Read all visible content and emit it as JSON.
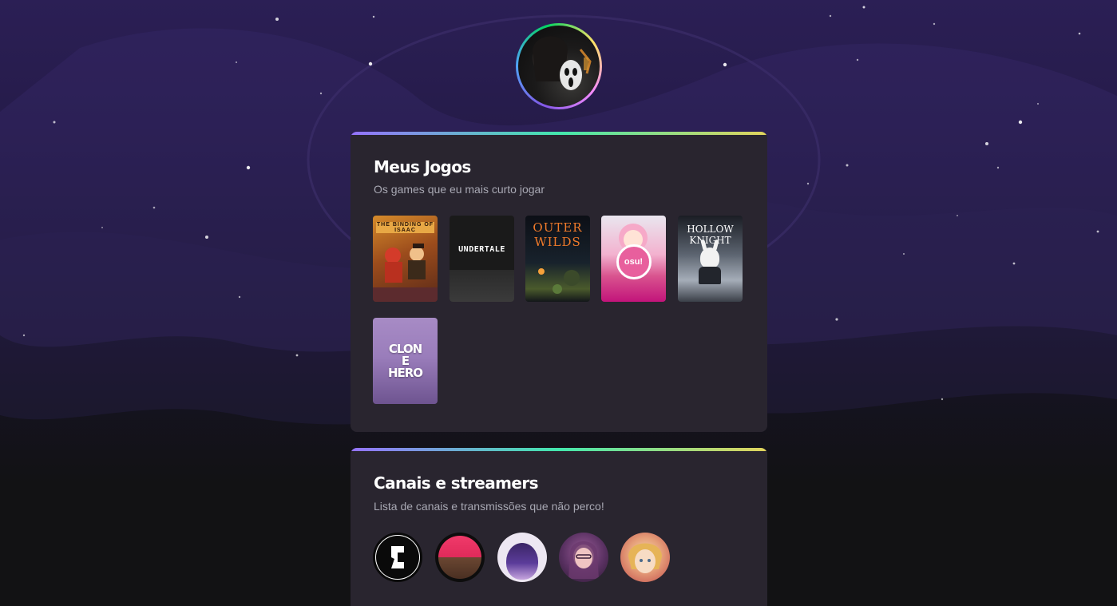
{
  "profile": {
    "avatar_icon": "profile-avatar-icon"
  },
  "games_section": {
    "title": "Meus Jogos",
    "subtitle": "Os games que eu mais curto jogar",
    "games": [
      {
        "label": "THE BINDING OF ISAAC",
        "icon": "binding-of-isaac-cover"
      },
      {
        "label": "UNDERTALE",
        "icon": "undertale-cover"
      },
      {
        "label": "OUTER WILDS",
        "icon": "outer-wilds-cover"
      },
      {
        "label": "osu!",
        "icon": "osu-cover"
      },
      {
        "label": "HOLLOW KNIGHT",
        "icon": "hollow-knight-cover"
      },
      {
        "label": "CLONE HERO",
        "icon": "clone-hero-cover"
      }
    ]
  },
  "streams_section": {
    "title": "Canais e streamers",
    "subtitle": "Lista de canais e transmissões que não perco!",
    "channels": [
      {
        "icon": "channel-1-avatar"
      },
      {
        "icon": "channel-2-avatar"
      },
      {
        "icon": "channel-3-avatar"
      },
      {
        "icon": "channel-4-avatar"
      },
      {
        "icon": "channel-5-avatar"
      }
    ]
  },
  "colors": {
    "card_bg": "#29252f",
    "accent_gradient": [
      "#9572fc",
      "#43e7ad",
      "#e2d45c"
    ],
    "title_text": "#ffffff",
    "subtitle_text": "#a8a8b3"
  }
}
